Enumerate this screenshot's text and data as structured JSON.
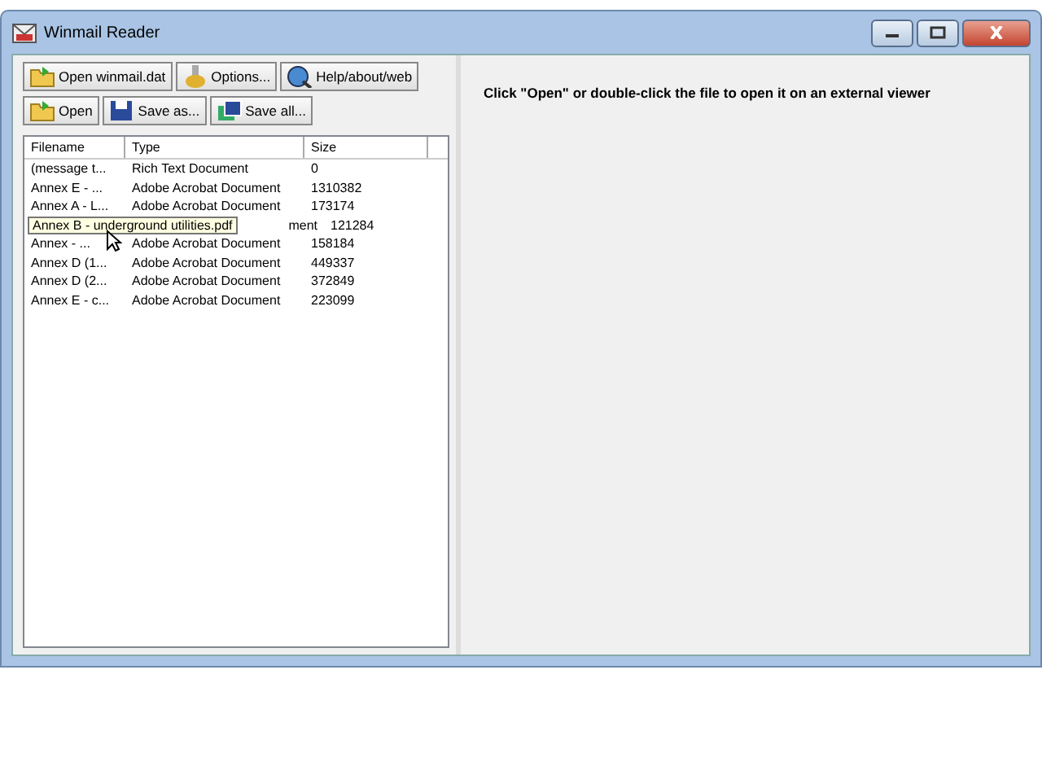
{
  "window": {
    "title": "Winmail Reader"
  },
  "toolbar_rows": [
    [
      {
        "label": "Open winmail.dat",
        "kind": "open"
      },
      {
        "label": "Options...",
        "kind": "options"
      },
      {
        "label": "Help/about/web",
        "kind": "help"
      }
    ],
    [
      {
        "label": "Open",
        "kind": "open"
      },
      {
        "label": "Save as...",
        "kind": "save"
      },
      {
        "label": "Save all...",
        "kind": "saveall"
      }
    ]
  ],
  "table": {
    "columns": [
      "Filename",
      "Type",
      "Size"
    ],
    "rows": [
      {
        "filename": "(message t...",
        "type": "Rich Text Document",
        "size": "0"
      },
      {
        "filename": "Annex E - ...",
        "type": "Adobe Acrobat Document",
        "size": "1310382"
      },
      {
        "filename": "Annex A - L...",
        "type": "Adobe Acrobat Document",
        "size": "173174"
      },
      {
        "tooltip": "Annex B - underground utilities.pdf",
        "type_tail": "ment",
        "size": "121284"
      },
      {
        "filename": "Annex - ...",
        "type": "Adobe Acrobat Document",
        "size": "158184"
      },
      {
        "filename": "Annex D (1...",
        "type": "Adobe Acrobat Document",
        "size": "449337"
      },
      {
        "filename": "Annex D (2...",
        "type": "Adobe Acrobat Document",
        "size": "372849"
      },
      {
        "filename": "Annex E - c...",
        "type": "Adobe Acrobat Document",
        "size": "223099"
      }
    ]
  },
  "hint": "Click \"Open\" or double-click the file to open it on an external viewer"
}
